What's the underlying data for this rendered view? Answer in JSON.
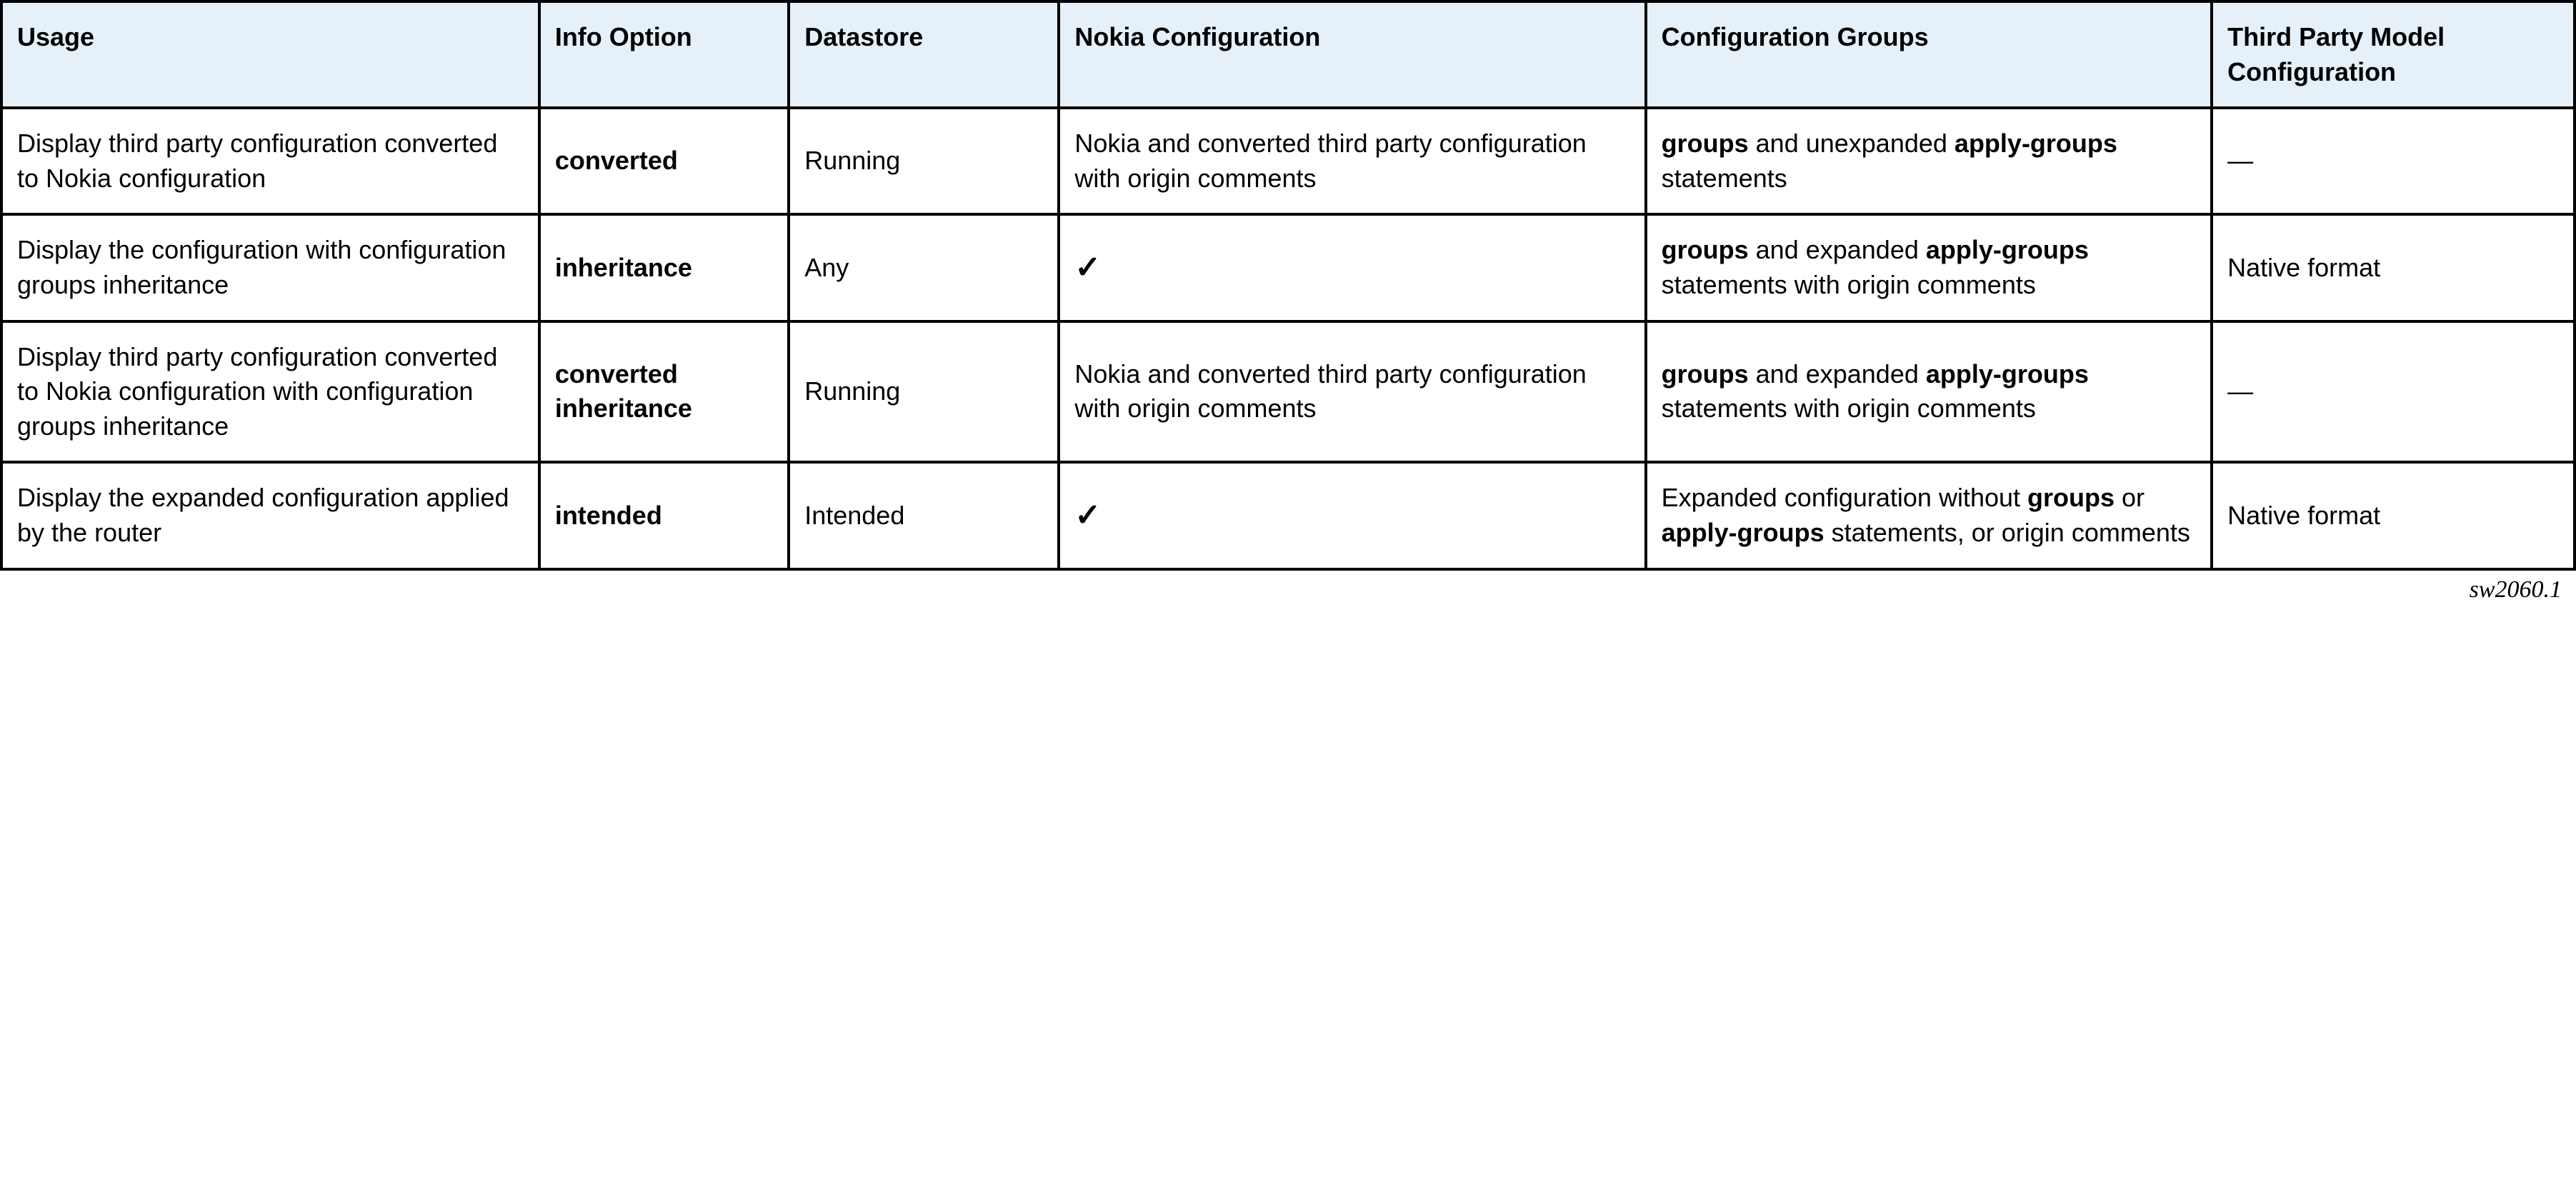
{
  "table": {
    "headers": {
      "usage": "Usage",
      "info_option": "Info Option",
      "datastore": "Datastore",
      "nokia_config": "Nokia Configuration",
      "config_groups": "Configuration Groups",
      "third_party": "Third Party Model Configuration"
    },
    "rows": [
      {
        "usage": "Display third party configuration converted to Nokia configuration",
        "info_option": "converted",
        "datastore": "Running",
        "nokia_config": "Nokia and converted third party configuration with origin comments",
        "config_groups_bold1": "groups",
        "config_groups_mid1": " and unexpanded ",
        "config_groups_bold2": "apply-groups",
        "config_groups_mid2": " statements",
        "third_party": "—"
      },
      {
        "usage": "Display the configuration with configuration groups inheritance",
        "info_option": "inheritance",
        "datastore": "Any",
        "nokia_config_check": "✓",
        "config_groups_bold1": "groups",
        "config_groups_mid1": " and expanded ",
        "config_groups_bold2": "apply-groups",
        "config_groups_mid2": " statements with origin comments",
        "third_party": "Native format"
      },
      {
        "usage": "Display third party configuration converted to Nokia configuration with configuration groups inheritance",
        "info_option": "converted inheritance",
        "datastore": "Running",
        "nokia_config": "Nokia and converted third party configuration with origin comments",
        "config_groups_bold1": "groups",
        "config_groups_mid1": " and expanded ",
        "config_groups_bold2": "apply-groups",
        "config_groups_mid2": " statements with origin comments",
        "third_party": "—"
      },
      {
        "usage": "Display the expanded configuration applied by the router",
        "info_option": "intended",
        "datastore": "Intended",
        "nokia_config_check": "✓",
        "config_groups_pre": "Expanded configuration without ",
        "config_groups_bold1": "groups",
        "config_groups_mid1": " or ",
        "config_groups_bold2": "apply-groups",
        "config_groups_mid2": " statements, or origin comments",
        "third_party": "Native format"
      }
    ]
  },
  "caption": "sw2060.1"
}
